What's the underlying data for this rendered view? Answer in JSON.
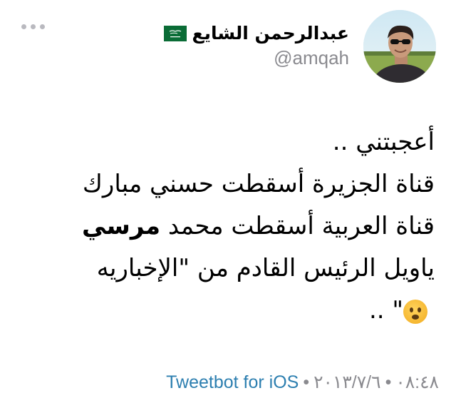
{
  "tweet": {
    "author": {
      "name": "عبدالرحمن الشايع",
      "handle": "@amqah",
      "flag_icon": "saudi-arabia-flag-icon"
    },
    "more_icon": "ellipsis-icon",
    "lines": [
      "أعجبتني ..",
      "قناة الجزيرة أسقطت حسني مبارك",
      "قناة العربية أسقطت محمد",
      "مرسي",
      "ياويل الرئيس القادم من \"الإخباريه",
      "\" .."
    ],
    "emoji_icon": "surprised-face-emoji",
    "meta": {
      "client": "Tweetbot for iOS",
      "separator": "•",
      "time": "٠٨:٤٨",
      "date": "٢٠١٣/٧/٦"
    }
  },
  "colors": {
    "link": "#2d7fb0",
    "muted": "#8a8a8f",
    "flag_green": "#0a6c36"
  }
}
